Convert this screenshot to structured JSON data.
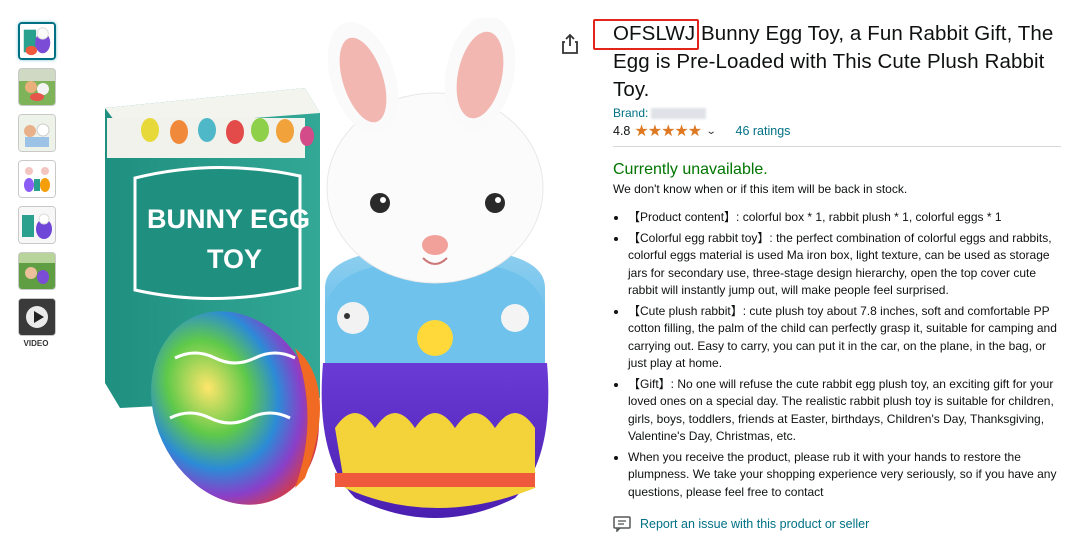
{
  "thumbnails": {
    "count": 7,
    "video_label": "VIDEO"
  },
  "product": {
    "brand_highlight": "OFSLWJ",
    "title_rest": " Bunny Egg Toy, a Fun Rabbit Gift, The Egg is Pre-Loaded with This Cute Plush Rabbit Toy.",
    "brand_label": "Brand:",
    "rating_value": "4.8",
    "stars": "★★★★★",
    "ratings_count": "46 ratings",
    "box_text_line1": "BUNNY EGG",
    "box_text_line2": "TOY"
  },
  "availability": {
    "status": "Currently unavailable.",
    "note": "We don't know when or if this item will be back in stock."
  },
  "bullets": [
    "【Product content】: colorful box * 1, rabbit plush * 1, colorful eggs * 1",
    "【Colorful egg rabbit toy】: the perfect combination of colorful eggs and rabbits, colorful eggs material is used Ma iron box, light texture, can be used as storage jars for secondary use, three-stage design hierarchy, open the top cover cute rabbit will instantly jump out, will make people feel surprised.",
    "【Cute plush rabbit】: cute plush toy about 7.8 inches, soft and comfortable PP cotton filling, the palm of the child can perfectly grasp it, suitable for camping and carrying out. Easy to carry, you can put it in the car, on the plane, in the bag, or just play at home.",
    "【Gift】: No one will refuse the cute rabbit egg plush toy, an exciting gift for your loved ones on a special day. The realistic rabbit plush toy is suitable for children, girls, boys, toddlers, friends at Easter, birthdays, Children's Day, Thanksgiving, Valentine's Day, Christmas, etc.",
    "When you receive the product, please rub it with your hands to restore the plumpness. We take your shopping experience very seriously, so if you have any questions, please feel free to contact"
  ],
  "report_link": "Report an issue with this product or seller",
  "colors": {
    "link": "#007185",
    "available": "#007600",
    "star": "#de7921",
    "highlight_box": "#e2251a"
  }
}
